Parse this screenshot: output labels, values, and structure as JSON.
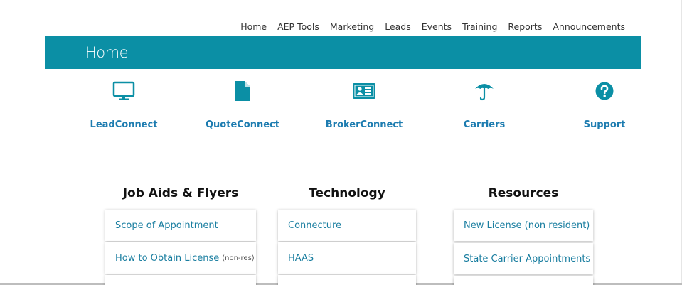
{
  "topnav": {
    "items": [
      {
        "label": "Home"
      },
      {
        "label": "AEP Tools"
      },
      {
        "label": "Marketing"
      },
      {
        "label": "Leads"
      },
      {
        "label": "Events"
      },
      {
        "label": "Training"
      },
      {
        "label": "Reports"
      },
      {
        "label": "Announcements"
      }
    ]
  },
  "banner": {
    "title": "Home",
    "color": "#0b8fa5"
  },
  "quick_links": [
    {
      "label": "LeadConnect",
      "icon": "monitor-icon"
    },
    {
      "label": "QuoteConnect",
      "icon": "document-icon"
    },
    {
      "label": "BrokerConnect",
      "icon": "id-card-icon"
    },
    {
      "label": "Carriers",
      "icon": "umbrella-icon"
    },
    {
      "label": "Support",
      "icon": "question-icon"
    }
  ],
  "columns": [
    {
      "heading": "Job Aids & Flyers",
      "links": [
        {
          "label": "Scope of Appointment",
          "note": ""
        },
        {
          "label": "How to Obtain License",
          "note": "(non-res)"
        }
      ]
    },
    {
      "heading": "Technology",
      "links": [
        {
          "label": "Connecture",
          "note": ""
        },
        {
          "label": "HAAS",
          "note": ""
        }
      ]
    },
    {
      "heading": "Resources",
      "links": [
        {
          "label": "New License (non resident)",
          "note": ""
        },
        {
          "label": "State Carrier Appointments",
          "note": ""
        }
      ]
    }
  ],
  "colors": {
    "accent": "#0b8fa5",
    "link": "#1d7cb0",
    "icon": "#0b8fa5"
  }
}
